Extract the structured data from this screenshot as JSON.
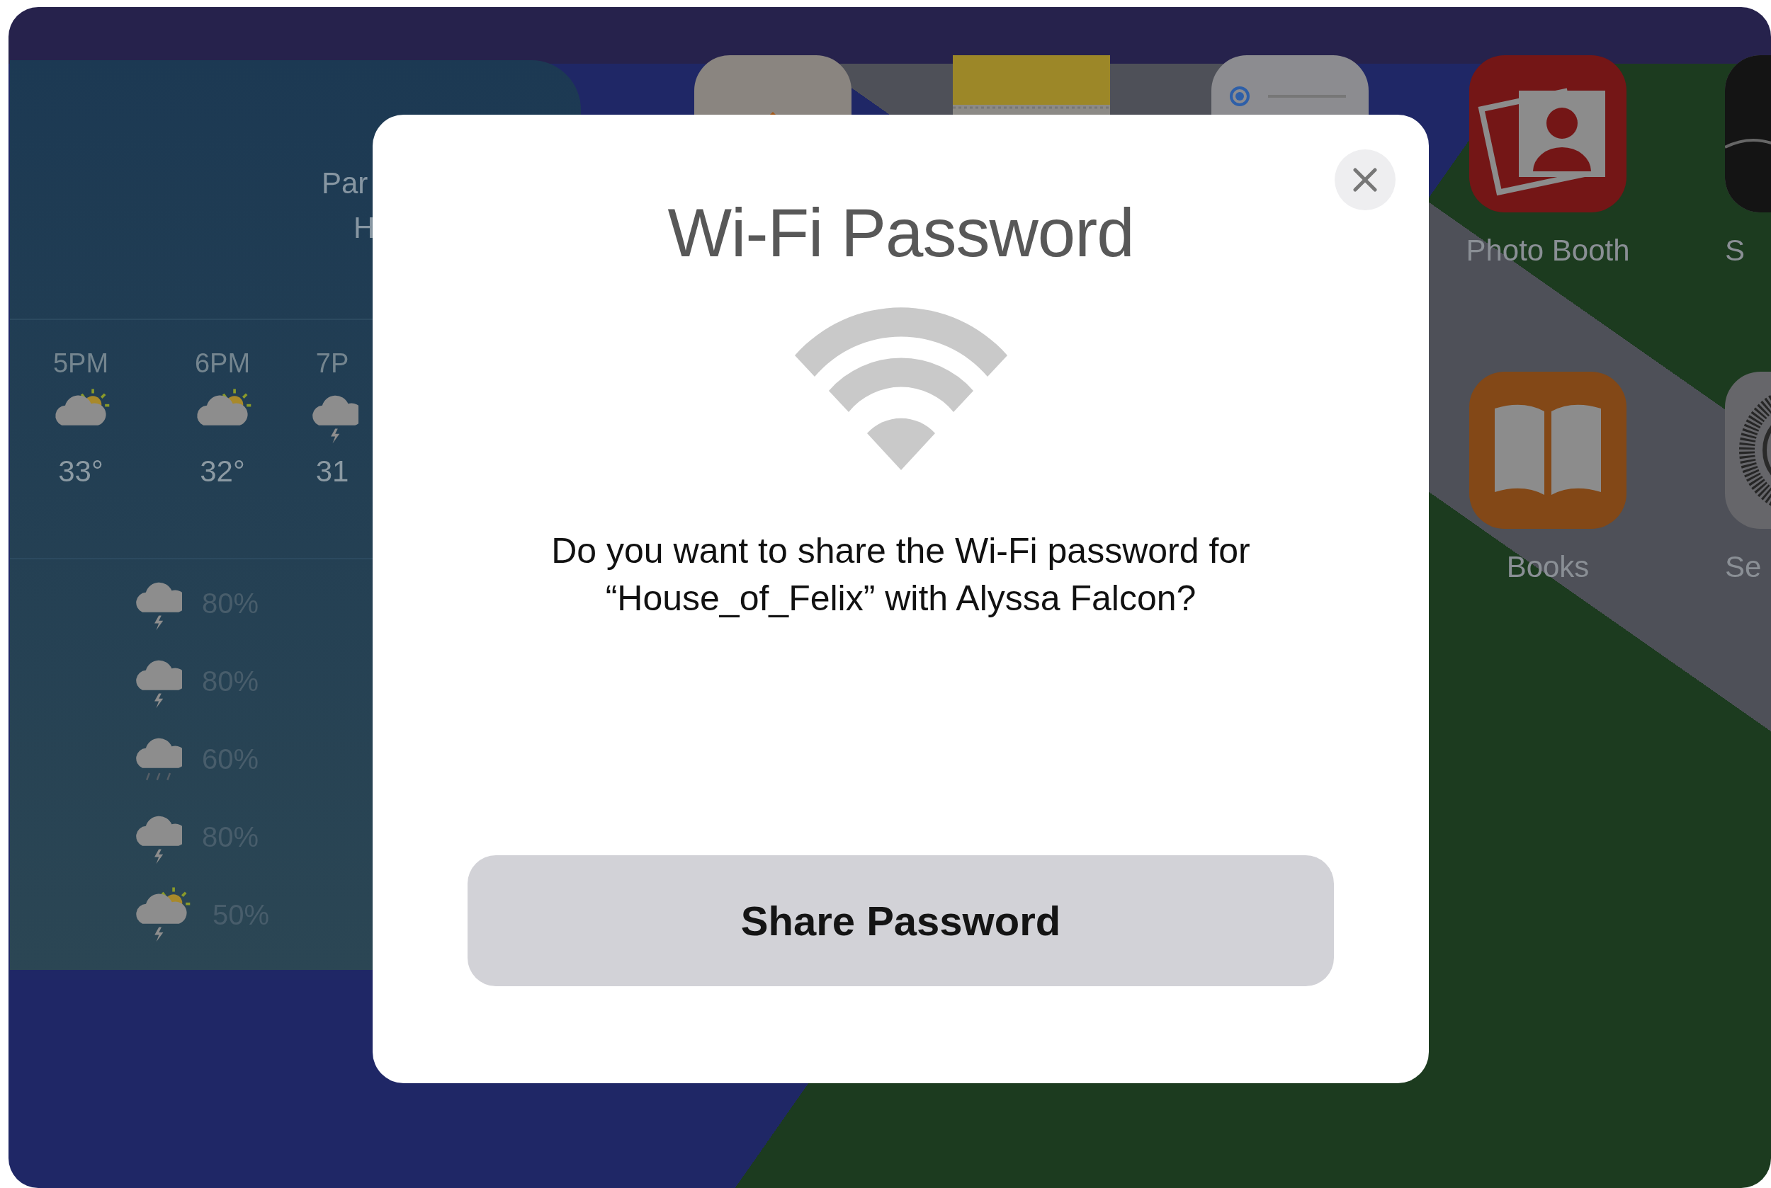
{
  "home_screen": {
    "weather_widget": {
      "location_lines": [
        "Par",
        "H"
      ],
      "hours": [
        {
          "time": "5PM",
          "temp": "33°",
          "kind": "partly-sunny"
        },
        {
          "time": "6PM",
          "temp": "32°",
          "kind": "partly-sunny"
        },
        {
          "time": "7P",
          "temp": "31",
          "kind": "thunder"
        }
      ],
      "precipitation": [
        {
          "chance": "80%",
          "kind": "thunder"
        },
        {
          "chance": "80%",
          "kind": "thunder"
        },
        {
          "chance": "60%",
          "kind": "rain"
        },
        {
          "chance": "80%",
          "kind": "thunder"
        },
        {
          "chance": "50%",
          "kind": "sunny-thunder"
        }
      ]
    },
    "top_row_icons": [
      {
        "kind": "home"
      },
      {
        "kind": "notes"
      },
      {
        "kind": "toggle"
      }
    ],
    "apps": [
      {
        "label": "Photo Booth",
        "kind": "photo-booth"
      },
      {
        "label": "S",
        "kind": "dark"
      },
      {
        "label": "Books",
        "kind": "books"
      },
      {
        "label": "Se",
        "kind": "gear"
      }
    ]
  },
  "dialog": {
    "title": "Wi-Fi Password",
    "message": "Do you want to share the Wi-Fi password for “House_of_Felix” with Alyssa Falcon?",
    "button": "Share Password"
  }
}
